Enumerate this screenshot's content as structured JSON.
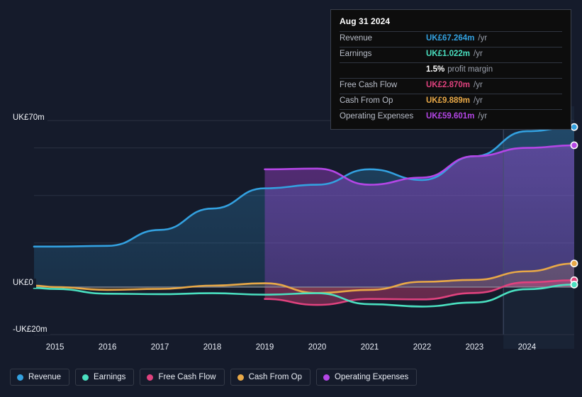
{
  "colors": {
    "background": "#151b2b",
    "revenue": "#33a1e0",
    "earnings": "#4ae0c0",
    "free_cash_flow": "#e0427e",
    "cash_from_op": "#e8a847",
    "operating_expenses": "#b446e6",
    "gridline": "#2a3142",
    "zero_line": "#8e94a0"
  },
  "tooltip": {
    "date": "Aug 31 2024",
    "rows": [
      {
        "label": "Revenue",
        "value": "UK£67.264m",
        "unit": "/yr",
        "color": "#33a1e0"
      },
      {
        "label": "Earnings",
        "value": "UK£1.022m",
        "unit": "/yr",
        "color": "#4ae0c0"
      },
      {
        "label": "",
        "value": "1.5%",
        "unit": "profit margin",
        "color": "#ffffff"
      },
      {
        "label": "Free Cash Flow",
        "value": "UK£2.870m",
        "unit": "/yr",
        "color": "#e0427e"
      },
      {
        "label": "Cash From Op",
        "value": "UK£9.889m",
        "unit": "/yr",
        "color": "#e8a847"
      },
      {
        "label": "Operating Expenses",
        "value": "UK£59.601m",
        "unit": "/yr",
        "color": "#b446e6"
      }
    ]
  },
  "legend": {
    "items": [
      {
        "label": "Revenue",
        "color": "#33a1e0"
      },
      {
        "label": "Earnings",
        "color": "#4ae0c0"
      },
      {
        "label": "Free Cash Flow",
        "color": "#e0427e"
      },
      {
        "label": "Cash From Op",
        "color": "#e8a847"
      },
      {
        "label": "Operating Expenses",
        "color": "#b446e6"
      }
    ]
  },
  "chart_data": {
    "type": "area",
    "title": "",
    "xlabel": "",
    "ylabel": "",
    "currency": "UK£",
    "unit": "m",
    "grid": true,
    "legend_position": "bottom",
    "ylim": [
      -20,
      70
    ],
    "y_ticks": [
      70,
      0,
      -20
    ],
    "y_tick_labels": [
      "UK£70m",
      "UK£0",
      "-UK£20m"
    ],
    "y_gridlines": [
      70,
      58.5,
      38.5,
      18.5,
      0,
      -20
    ],
    "x": [
      2014.6,
      2015,
      2016,
      2017,
      2018,
      2019,
      2020,
      2021,
      2022,
      2023,
      2024,
      2024.9
    ],
    "x_ticks": [
      2015,
      2016,
      2017,
      2018,
      2019,
      2020,
      2021,
      2022,
      2023,
      2024
    ],
    "x_tick_labels": [
      "2015",
      "2016",
      "2017",
      "2018",
      "2019",
      "2020",
      "2021",
      "2022",
      "2023",
      "2024"
    ],
    "forecast_divider_x": 2023.55,
    "series": [
      {
        "name": "Revenue",
        "color": "#33a1e0",
        "values": [
          17.0,
          17.0,
          17.3,
          24.0,
          33.0,
          41.5,
          43.0,
          49.5,
          45.0,
          55.0,
          65.5,
          67.264
        ]
      },
      {
        "name": "Earnings",
        "color": "#4ae0c0",
        "values": [
          -0.4,
          -0.8,
          -2.8,
          -3.0,
          -2.6,
          -3.2,
          -2.6,
          -7.2,
          -8.2,
          -6.5,
          -0.9,
          1.022
        ]
      },
      {
        "name": "Free Cash Flow",
        "color": "#e0427e",
        "values": [
          null,
          null,
          null,
          null,
          null,
          -5.0,
          -7.5,
          -5.0,
          -5.2,
          -2.5,
          2.0,
          2.87
        ]
      },
      {
        "name": "Cash From Op",
        "color": "#e8a847",
        "values": [
          0.6,
          0.0,
          -1.2,
          -0.8,
          0.6,
          1.6,
          -2.5,
          -1.2,
          2.2,
          3.0,
          6.6,
          9.889
        ]
      },
      {
        "name": "Operating Expenses",
        "color": "#b446e6",
        "values": [
          null,
          null,
          null,
          null,
          null,
          49.5,
          49.8,
          43.0,
          46.0,
          55.0,
          58.5,
          59.601
        ]
      }
    ]
  }
}
